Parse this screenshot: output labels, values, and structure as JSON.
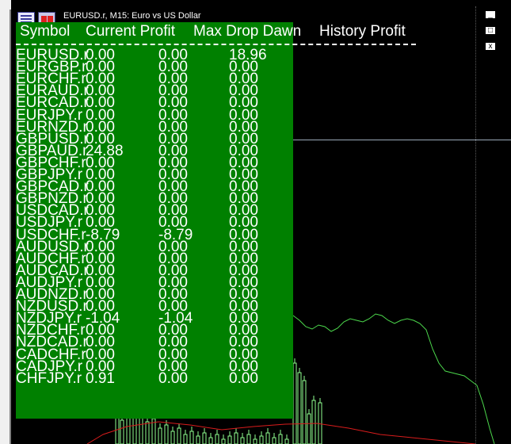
{
  "window": {
    "title": "EURUSD.r, M15:  Euro vs US Dollar",
    "controls": [
      "_",
      "□",
      "x"
    ]
  },
  "table": {
    "headers": {
      "symbol": "Symbol",
      "current_profit": "Current Profit",
      "max_drop": "Max Drop Dawn",
      "history_profit": "History Profit"
    },
    "rows": [
      {
        "symbol": "EURUSD.r",
        "current": "0.00",
        "maxdrop": "0.00",
        "history": "18.96"
      },
      {
        "symbol": "EURGBP.r",
        "current": "0.00",
        "maxdrop": "0.00",
        "history": "0.00"
      },
      {
        "symbol": "EURCHF.r",
        "current": "0.00",
        "maxdrop": "0.00",
        "history": "0.00"
      },
      {
        "symbol": "EURAUD.r",
        "current": "0.00",
        "maxdrop": "0.00",
        "history": "0.00"
      },
      {
        "symbol": "EURCAD.r",
        "current": "0.00",
        "maxdrop": "0.00",
        "history": "0.00"
      },
      {
        "symbol": "EURJPY.r",
        "current": "0.00",
        "maxdrop": "0.00",
        "history": "0.00"
      },
      {
        "symbol": "EURNZD.r",
        "current": "0.00",
        "maxdrop": "0.00",
        "history": "0.00"
      },
      {
        "symbol": "GBPUSD.r",
        "current": "0.00",
        "maxdrop": "0.00",
        "history": "0.00"
      },
      {
        "symbol": "GBPAUD.r",
        "current": "24.88",
        "maxdrop": "0.00",
        "history": "0.00"
      },
      {
        "symbol": "GBPCHF.r",
        "current": "0.00",
        "maxdrop": "0.00",
        "history": "0.00"
      },
      {
        "symbol": "GBPJPY.r",
        "current": "0.00",
        "maxdrop": "0.00",
        "history": "0.00"
      },
      {
        "symbol": "GBPCAD.r",
        "current": "0.00",
        "maxdrop": "0.00",
        "history": "0.00"
      },
      {
        "symbol": "GBPNZD.r",
        "current": "0.00",
        "maxdrop": "0.00",
        "history": "0.00"
      },
      {
        "symbol": "USDCAD.r",
        "current": "0.00",
        "maxdrop": "0.00",
        "history": "0.00"
      },
      {
        "symbol": "USDJPY.r",
        "current": "0.00",
        "maxdrop": "0.00",
        "history": "0.00"
      },
      {
        "symbol": "USDCHF.r",
        "current": "-8.79",
        "maxdrop": "-8.79",
        "history": "0.00"
      },
      {
        "symbol": "AUDUSD.r",
        "current": "0.00",
        "maxdrop": "0.00",
        "history": "0.00"
      },
      {
        "symbol": "AUDCHF.r",
        "current": "0.00",
        "maxdrop": "0.00",
        "history": "0.00"
      },
      {
        "symbol": "AUDCAD.r",
        "current": "0.00",
        "maxdrop": "0.00",
        "history": "0.00"
      },
      {
        "symbol": "AUDJPY.r",
        "current": "0.00",
        "maxdrop": "0.00",
        "history": "0.00"
      },
      {
        "symbol": "AUDNZD.r",
        "current": "0.00",
        "maxdrop": "0.00",
        "history": "0.00"
      },
      {
        "symbol": "NZDUSD.r",
        "current": "0.00",
        "maxdrop": "0.00",
        "history": "0.00"
      },
      {
        "symbol": "NZDJPY.r",
        "current": "-1.04",
        "maxdrop": "-1.04",
        "history": "0.00"
      },
      {
        "symbol": "NZDCHF.r",
        "current": "0.00",
        "maxdrop": "0.00",
        "history": "0.00"
      },
      {
        "symbol": "NZDCAD.r",
        "current": "0.00",
        "maxdrop": "0.00",
        "history": "0.00"
      },
      {
        "symbol": "CADCHF.r",
        "current": "0.00",
        "maxdrop": "0.00",
        "history": "0.00"
      },
      {
        "symbol": "CADJPY.r",
        "current": "0.00",
        "maxdrop": "0.00",
        "history": "0.00"
      },
      {
        "symbol": "CHFJPY.r",
        "current": "0.91",
        "maxdrop": "0.00",
        "history": "0.00"
      }
    ]
  },
  "colors": {
    "panel": "#008000",
    "chart_background": "#000000",
    "indicator_line": "#4cd84c",
    "moving_average": "#d81c1c",
    "candles": "#90ff90"
  }
}
